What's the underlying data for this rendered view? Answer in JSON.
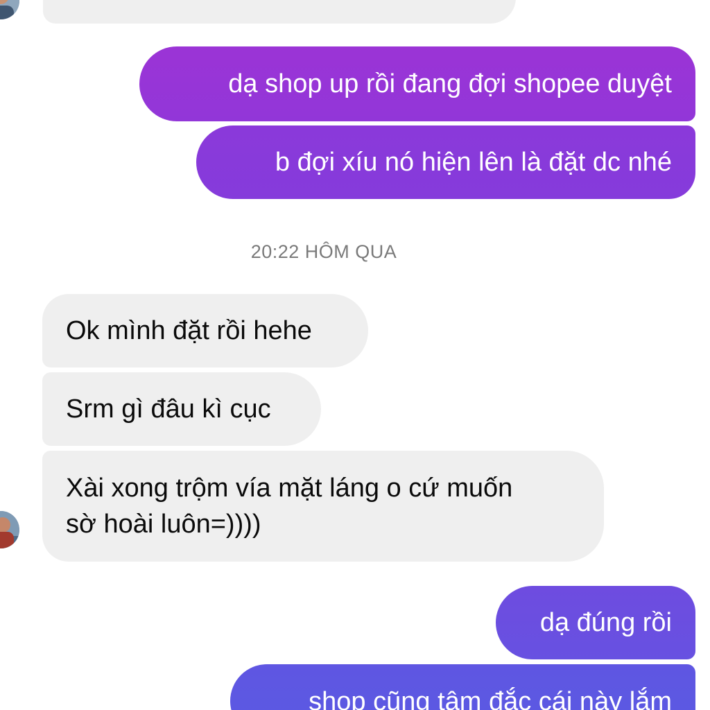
{
  "conversation": {
    "timestamp": "20:22 HÔM QUA",
    "messages": [
      {
        "direction": "incoming",
        "text": ""
      },
      {
        "direction": "outgoing",
        "text": "dạ shop up rồi đang đợi shopee duyệt"
      },
      {
        "direction": "outgoing",
        "text": "b đợi xíu nó hiện lên là đặt dc nhé"
      },
      {
        "direction": "incoming",
        "text": "Ok mình đặt rồi hehe"
      },
      {
        "direction": "incoming",
        "text": "Srm gì đâu kì cục"
      },
      {
        "direction": "incoming",
        "lines": [
          "Xài xong trộm vía mặt láng o cứ muốn",
          "sờ hoài luôn=))))"
        ]
      },
      {
        "direction": "outgoing",
        "text": "dạ đúng rồi"
      },
      {
        "direction": "outgoing",
        "text": "shop cũng tâm đắc cái này lắm"
      }
    ]
  },
  "colors": {
    "incoming_bubble": "#efefef",
    "outgoing_gradient_top": "#9b34d6",
    "outgoing_gradient_bottom": "#4f6ae3",
    "timestamp_text": "#7a7a7a"
  },
  "icons": {
    "contact_avatar": "avatar-photo"
  }
}
